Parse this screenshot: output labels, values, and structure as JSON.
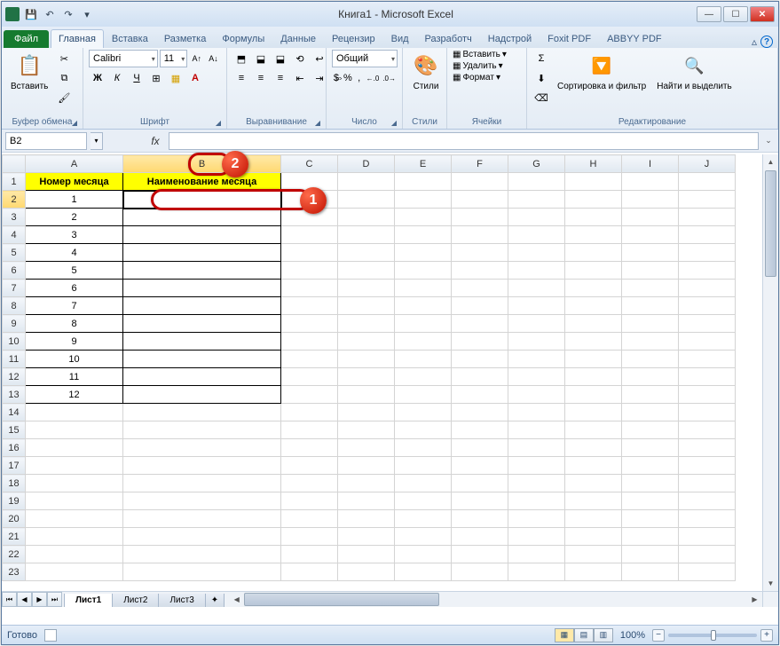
{
  "window_title": "Книга1  -  Microsoft Excel",
  "qat": {
    "save": "💾",
    "undo": "↶",
    "redo": "↷"
  },
  "win_controls": {
    "min": "—",
    "max": "☐",
    "close": "✕"
  },
  "file_tab": "Файл",
  "tabs": [
    "Главная",
    "Вставка",
    "Разметка",
    "Формулы",
    "Данные",
    "Рецензир",
    "Вид",
    "Разработч",
    "Надстрой",
    "Foxit PDF",
    "ABBYY PDF"
  ],
  "active_tab": "Главная",
  "help": {
    "minimize_ribbon": "▵",
    "help": "?"
  },
  "ribbon": {
    "clipboard": {
      "label": "Буфер обмена",
      "paste": "Вставить",
      "cut": "✂",
      "copy": "⧉",
      "fmt": "🖌"
    },
    "font": {
      "label": "Шрифт",
      "name": "Calibri",
      "size": "11",
      "bold": "Ж",
      "italic": "К",
      "underline": "Ч",
      "border": "⊞",
      "fill": "▦",
      "color": "A",
      "grow": "A↑",
      "shrink": "A↓"
    },
    "align": {
      "label": "Выравнивание",
      "top": "⬒",
      "mid": "⬓",
      "bot": "⬓",
      "left": "≡",
      "center": "≡",
      "right": "≡",
      "indent_dec": "⇤",
      "indent_inc": "⇥",
      "wrap": "↩",
      "merge": "⇔",
      "orient": "⟲"
    },
    "number": {
      "label": "Число",
      "format": "Общий",
      "currency": "$",
      "percent": "%",
      "comma": ",",
      "inc": "←.0",
      "dec": ".0→"
    },
    "styles": {
      "label": "Стили",
      "styles_btn": "Стили"
    },
    "cells": {
      "label": "Ячейки",
      "insert": "Вставить",
      "delete": "Удалить",
      "format": "Формат"
    },
    "editing": {
      "label": "Редактирование",
      "sum": "Σ",
      "fill": "⬇",
      "clear": "⌫",
      "sort": "Сортировка и фильтр",
      "find": "Найти и выделить"
    }
  },
  "name_box": "B2",
  "fx_label": "fx",
  "formula_value": "",
  "columns": [
    "A",
    "B",
    "C",
    "D",
    "E",
    "F",
    "G",
    "H",
    "I",
    "J"
  ],
  "header_row": {
    "A": "Номер месяца",
    "B": "Наименование месяца"
  },
  "data_rows": [
    {
      "n": 1,
      "A": "1",
      "B": ""
    },
    {
      "n": 2,
      "A": "2",
      "B": ""
    },
    {
      "n": 3,
      "A": "3",
      "B": ""
    },
    {
      "n": 4,
      "A": "4",
      "B": ""
    },
    {
      "n": 5,
      "A": "5",
      "B": ""
    },
    {
      "n": 6,
      "A": "6",
      "B": ""
    },
    {
      "n": 7,
      "A": "7",
      "B": ""
    },
    {
      "n": 8,
      "A": "8",
      "B": ""
    },
    {
      "n": 9,
      "A": "9",
      "B": ""
    },
    {
      "n": 10,
      "A": "10",
      "B": ""
    },
    {
      "n": 11,
      "A": "11",
      "B": ""
    },
    {
      "n": 12,
      "A": "12",
      "B": ""
    }
  ],
  "empty_row_count": 10,
  "sheet_tabs": [
    "Лист1",
    "Лист2",
    "Лист3"
  ],
  "active_sheet": "Лист1",
  "status": "Готово",
  "zoom": "100%",
  "callouts": {
    "one": "1",
    "two": "2"
  }
}
